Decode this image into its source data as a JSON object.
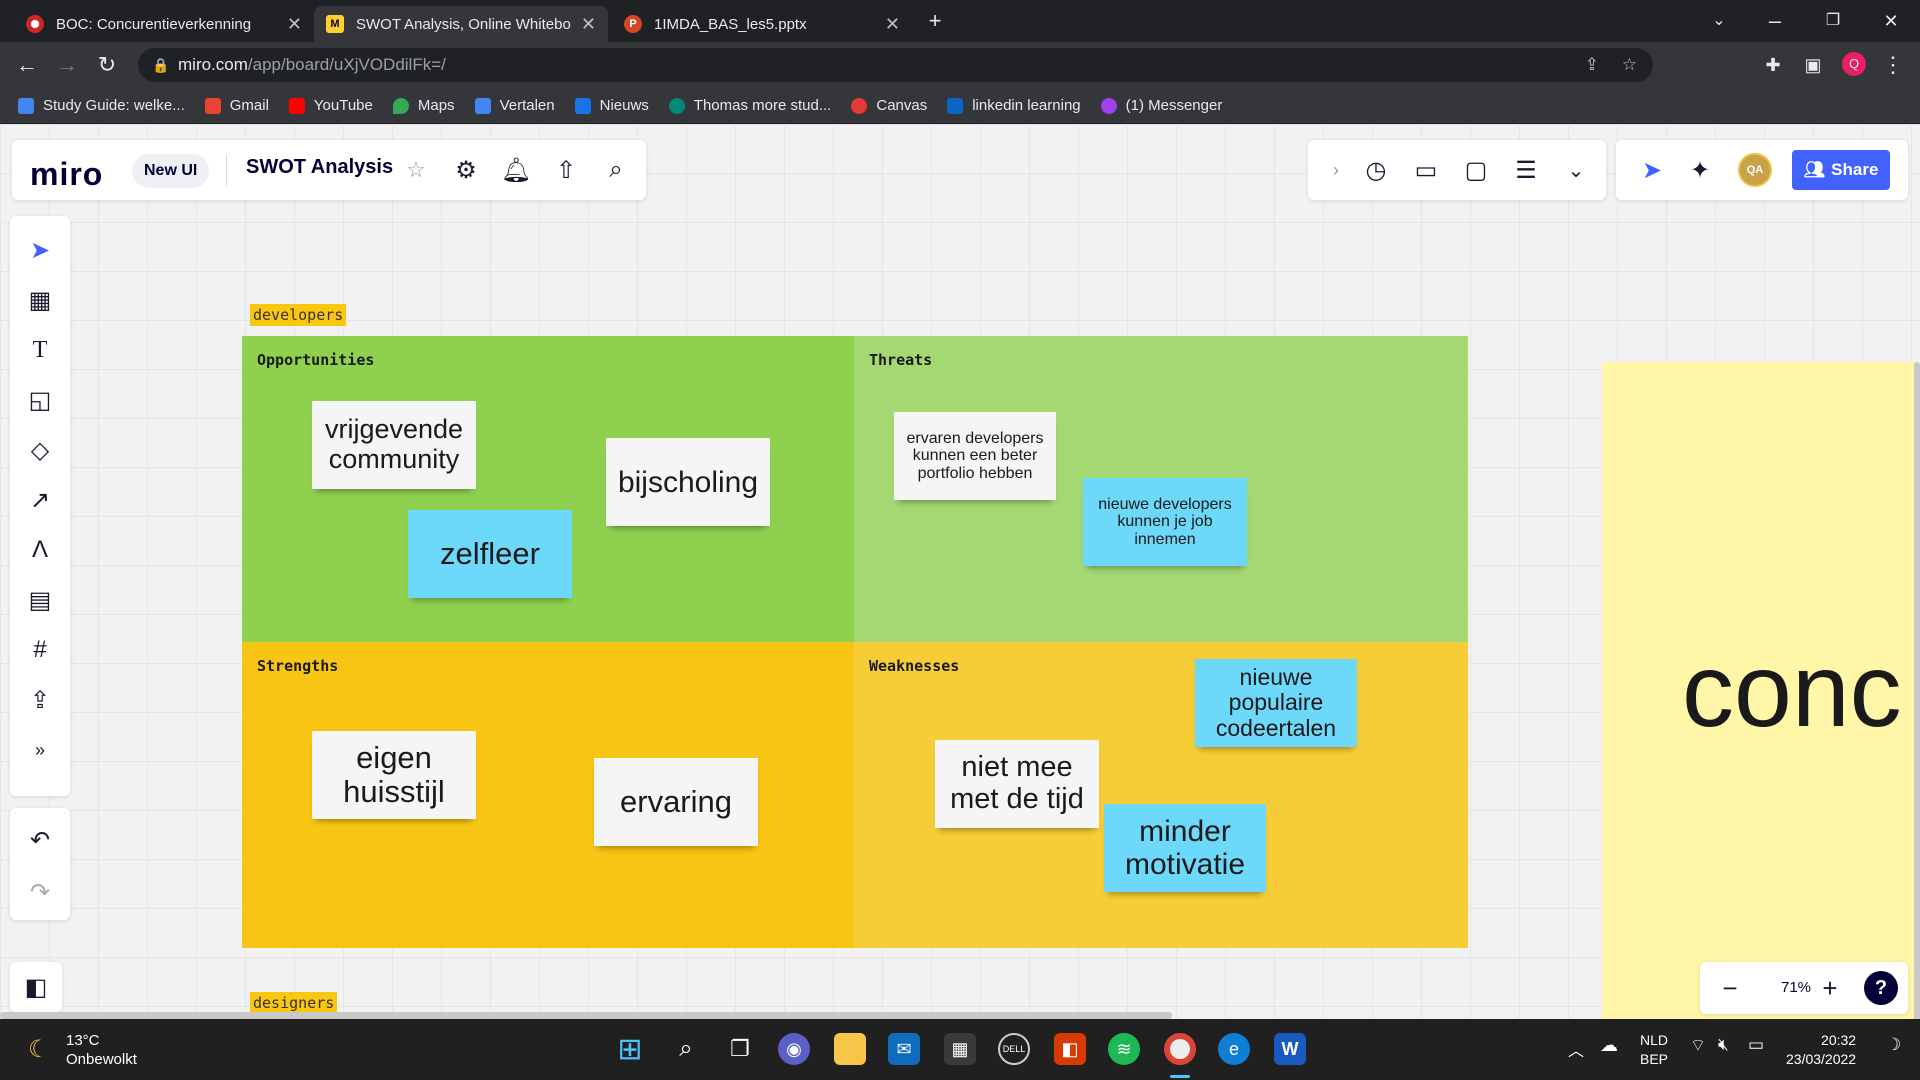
{
  "tabs": [
    {
      "title": "BOC: Concurentieverkenning",
      "active": false
    },
    {
      "title": "SWOT Analysis, Online Whiteboa",
      "active": true
    },
    {
      "title": "1IMDA_BAS_les5.pptx",
      "active": false
    }
  ],
  "url": {
    "host": "miro.com",
    "path": "/app/board/uXjVODdilFk=/"
  },
  "bookmarks": [
    "Study Guide: welke...",
    "Gmail",
    "YouTube",
    "Maps",
    "Vertalen",
    "Nieuws",
    "Thomas more stud...",
    "Canvas",
    "linkedin learning",
    "(1) Messenger"
  ],
  "miro": {
    "logo": "miro",
    "new_ui": "New UI",
    "board_title": "SWOT Analysis",
    "share": "Share",
    "avatar": "QA",
    "zoom": "71%",
    "help": "?"
  },
  "board": {
    "tag_top": "developers",
    "tag_bottom": "designers",
    "quadrants": {
      "opportunities": "Opportunities",
      "threats": "Threats",
      "strengths": "Strengths",
      "weaknesses": "Weaknesses"
    },
    "stickies": {
      "vrij": "vrijgevende community",
      "bijs": "bijscholing",
      "zelf": "zelfleer",
      "erv_dev": "ervaren developers kunnen een beter portfolio hebben",
      "nieuwe_dev": "nieuwe developers kunnen je job innemen",
      "eigen": "eigen huisstijl",
      "ervaring": "ervaring",
      "nieuwe_talen": "nieuwe populaire codeertalen",
      "niet_mee": "niet mee met de tijd",
      "minder": "minder motivatie"
    },
    "big_text": "conc"
  },
  "taskbar": {
    "temp": "13°C",
    "weather": "Onbewolkt",
    "lang1": "NLD",
    "lang2": "BEP",
    "time": "20:32",
    "date": "23/03/2022"
  }
}
